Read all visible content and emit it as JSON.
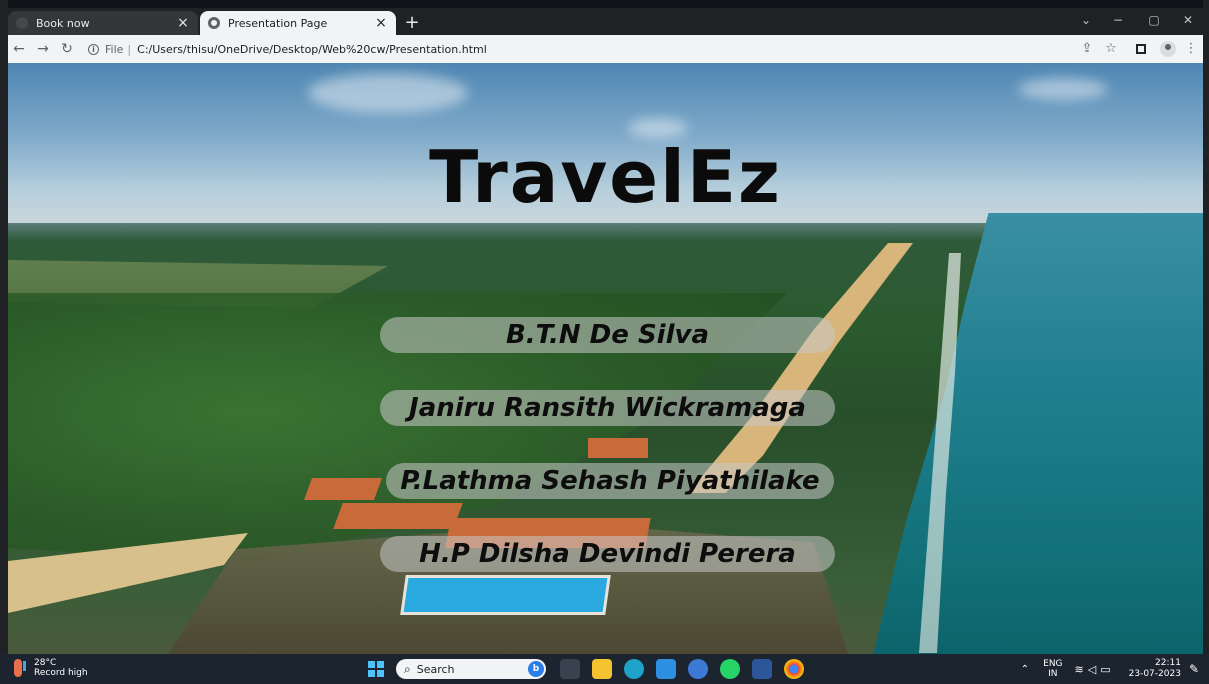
{
  "browser": {
    "tabs": [
      {
        "title": "Book now",
        "active": false
      },
      {
        "title": "Presentation Page",
        "active": true
      }
    ],
    "new_tab_symbol": "+",
    "address": {
      "scheme_label": "File",
      "separator": "|",
      "url": "C:/Users/thisu/OneDrive/Desktop/Web%20cw/Presentation.html"
    },
    "window_controls": {
      "dropdown": "⌄",
      "minimize": "−",
      "maximize": "▢",
      "close": "✕"
    }
  },
  "page": {
    "title": "TravelEz",
    "names": [
      "B.T.N De Silva",
      "Janiru Ransith Wickramaga",
      "P.Lathma Sehash Piyathilake",
      "H.P Dilsha Devindi Perera"
    ]
  },
  "taskbar": {
    "weather_temp": "28°C",
    "weather_desc": "Record high",
    "search_placeholder": "Search",
    "lang_top": "ENG",
    "lang_bottom": "IN",
    "time": "22:11",
    "date": "23-07-2023"
  },
  "colors": {
    "title_text": "#0b0b0b",
    "pill_bg": "rgba(200,200,200,0.55)",
    "taskbar_bg": "#1c2430"
  }
}
